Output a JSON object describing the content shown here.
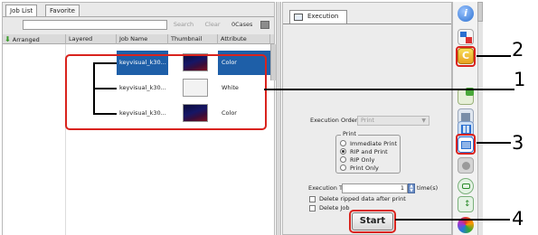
{
  "left_panel": {
    "tabs": [
      "Job List",
      "Favorite"
    ],
    "search": {
      "value": "",
      "search_label": "Search",
      "clear_label": "Clear",
      "cases": "0Cases"
    },
    "columns": {
      "arranged": "Arranged",
      "layered": "Layered",
      "job_name": "Job Name",
      "thumbnail": "Thumbnail",
      "attribute": "Attribute"
    },
    "jobs": [
      {
        "name": "keyvisual_k30...",
        "attribute": "Color",
        "thumbnail": "dark",
        "selected": true
      },
      {
        "name": "keyvisual_k30...",
        "attribute": "White",
        "thumbnail": "white",
        "selected": false
      },
      {
        "name": "keyvisual_k30...",
        "attribute": "Color",
        "thumbnail": "dark",
        "selected": false
      }
    ]
  },
  "right_panel": {
    "tab_label": "Execution",
    "execution_order": {
      "label": "Execution Order",
      "value": "Print"
    },
    "print_group": {
      "legend": "Print",
      "options": [
        "Immediate Print",
        "RIP and Print",
        "RIP Only",
        "Print Only"
      ],
      "selected_index": 1
    },
    "execution_times": {
      "label": "Execution Times",
      "value": "1",
      "unit": "time(s)"
    },
    "checkboxes": [
      "Delete ripped data after print",
      "Delete Job"
    ],
    "start_label": "Start"
  },
  "icon_strip": {
    "icons": [
      "info-icon",
      "layout-icon",
      "setting-c-icon",
      "crop-icon",
      "check-icon",
      "dark-icon",
      "grid-icon",
      "execution-icon",
      "gear-icon",
      "print-icon",
      "move-icon",
      "color-icon"
    ]
  },
  "callouts": [
    "1",
    "2",
    "3",
    "4"
  ],
  "colors": {
    "callout_red": "#d9231d",
    "selected_row": "#1e5fa8",
    "accent_blue": "#2a6fd0"
  }
}
